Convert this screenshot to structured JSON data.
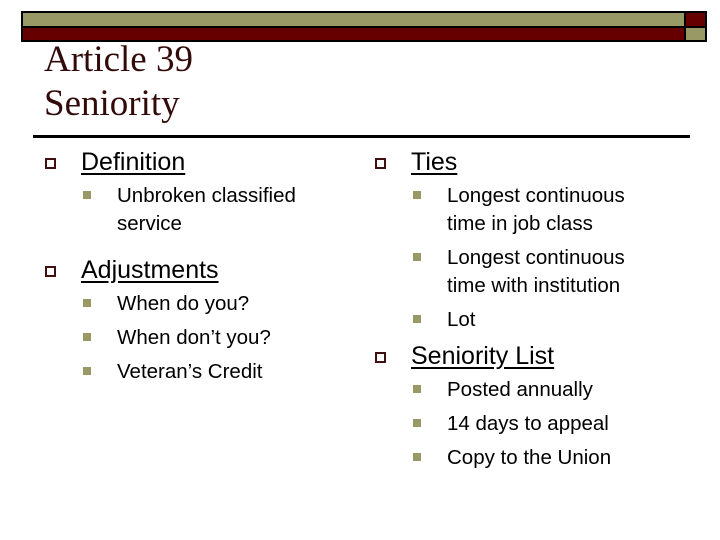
{
  "slide": {
    "title_line1": "Article 39",
    "title_line2": "Seniority",
    "colors": {
      "accent_olive": "#999966",
      "accent_maroon": "#660000",
      "title": "#330a0a"
    }
  },
  "left_column": [
    {
      "heading": "Definition",
      "items": [
        "Unbroken classified service"
      ]
    },
    {
      "heading": "Adjustments",
      "items": [
        "When do you?",
        "When don’t you?",
        "Veteran’s Credit"
      ]
    }
  ],
  "right_column": [
    {
      "heading": "Ties",
      "items": [
        "Longest continuous time in job class",
        "Longest continuous time with institution",
        "Lot"
      ]
    },
    {
      "heading": "Seniority List",
      "items": [
        "Posted annually",
        "14 days to appeal",
        "Copy to the Union"
      ]
    }
  ]
}
